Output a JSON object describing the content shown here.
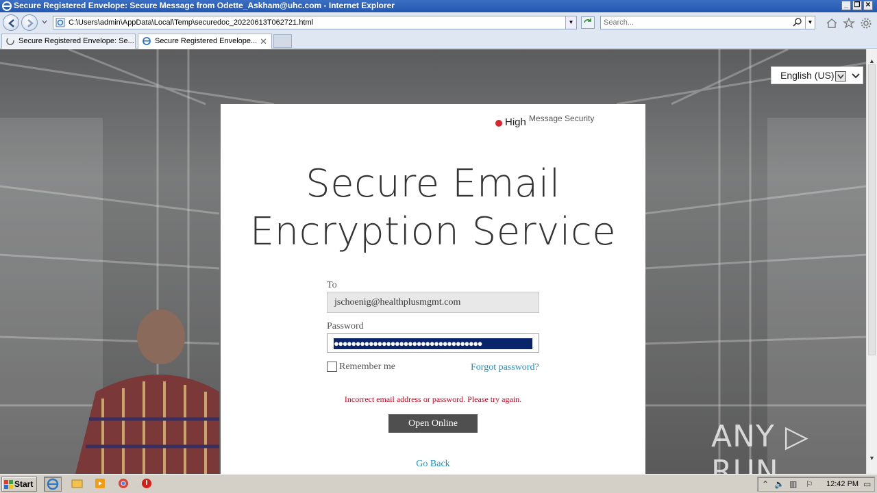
{
  "window": {
    "title": "Secure Registered Envelope: Secure Message from Odette_Askham@uhc.com - Internet Explorer",
    "controls": [
      "_",
      "❐",
      "✕"
    ]
  },
  "browser": {
    "address": "C:\\Users\\admin\\AppData\\Local\\Temp\\securedoc_20220613T062721.html",
    "search_placeholder": "Search...",
    "tabs": [
      {
        "label": "Secure Registered Envelope: Se...",
        "active": false
      },
      {
        "label": "Secure Registered Envelope...",
        "active": true,
        "close": "✕"
      }
    ]
  },
  "page": {
    "language": "English (US)",
    "security_level": "High",
    "security_label": "Message Security",
    "heading_line1": "Secure Email",
    "heading_line2": "Encryption Service",
    "to_label": "To",
    "to_value": "jschoenig@healthplusmgmt.com",
    "password_label": "Password",
    "password_mask": "●●●●●●●●●●●●●●●●●●●●●●●●●●●●●●●●●●",
    "remember_label": "Remember me",
    "forgot_label": "Forgot password?",
    "error_text": "Incorrect email address or password. Please try again.",
    "open_button": "Open Online",
    "go_back": "Go Back",
    "watermark": "ANY ▷ RUN"
  },
  "taskbar": {
    "start_label": "Start",
    "clock": "12:42 PM"
  },
  "colors": {
    "accent_link": "#1b8fc2",
    "error": "#d0021b",
    "security_dot": "#d8262b",
    "button": "#4f4f4f"
  }
}
